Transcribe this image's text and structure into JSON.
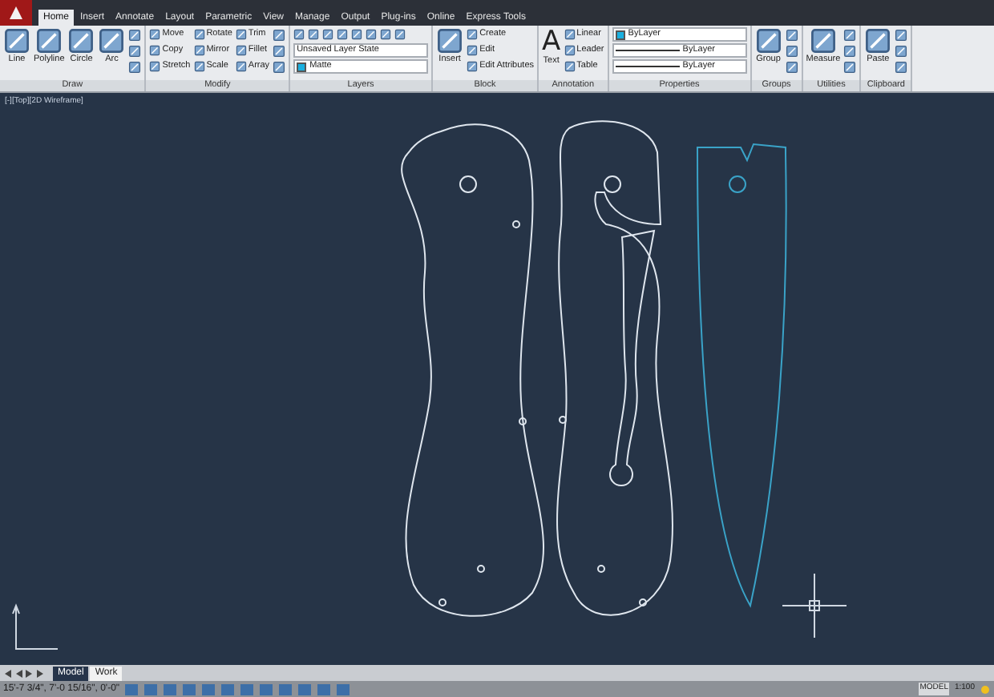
{
  "tabs": [
    {
      "label": "Home",
      "selected": true
    },
    {
      "label": "Insert",
      "selected": false
    },
    {
      "label": "Annotate",
      "selected": false
    },
    {
      "label": "Layout",
      "selected": false
    },
    {
      "label": "Parametric",
      "selected": false
    },
    {
      "label": "View",
      "selected": false
    },
    {
      "label": "Manage",
      "selected": false
    },
    {
      "label": "Output",
      "selected": false
    },
    {
      "label": "Plug-ins",
      "selected": false
    },
    {
      "label": "Online",
      "selected": false
    },
    {
      "label": "Express Tools",
      "selected": false
    }
  ],
  "panels": [
    {
      "title": "Draw",
      "columns": [
        [
          {
            "kind": "large",
            "label": "Line"
          }
        ],
        [
          {
            "kind": "large",
            "label": "Polyline"
          }
        ],
        [
          {
            "kind": "large",
            "label": "Circle"
          }
        ],
        [
          {
            "kind": "large",
            "label": "Arc"
          }
        ],
        [
          {
            "kind": "icon"
          },
          {
            "kind": "icon"
          },
          {
            "kind": "icon"
          }
        ]
      ]
    },
    {
      "title": "Modify",
      "columns": [
        [
          {
            "kind": "small",
            "label": "Move"
          },
          {
            "kind": "small",
            "label": "Copy"
          },
          {
            "kind": "small",
            "label": "Stretch"
          }
        ],
        [
          {
            "kind": "small",
            "label": "Rotate"
          },
          {
            "kind": "small",
            "label": "Mirror"
          },
          {
            "kind": "small",
            "label": "Scale"
          }
        ],
        [
          {
            "kind": "small",
            "label": "Trim"
          },
          {
            "kind": "small",
            "label": "Fillet"
          },
          {
            "kind": "small",
            "label": "Array"
          }
        ],
        [
          {
            "kind": "icon"
          },
          {
            "kind": "icon"
          },
          {
            "kind": "icon"
          }
        ]
      ]
    },
    {
      "title": "Layers",
      "columns": [
        [
          {
            "kind": "iconrow"
          },
          {
            "kind": "dropdown",
            "label": "Unsaved Layer State"
          },
          {
            "kind": "dropdown",
            "label": "Matte",
            "color": "#1ab0e0"
          }
        ]
      ]
    },
    {
      "title": "Block",
      "columns": [
        [
          {
            "kind": "large",
            "label": "Insert"
          }
        ],
        [
          {
            "kind": "small",
            "label": "Create"
          },
          {
            "kind": "small",
            "label": "Edit"
          },
          {
            "kind": "small",
            "label": "Edit Attributes"
          }
        ]
      ]
    },
    {
      "title": "Annotation",
      "columns": [
        [
          {
            "kind": "text",
            "label": "Text",
            "glyph": "A"
          }
        ],
        [
          {
            "kind": "small",
            "label": "Linear"
          },
          {
            "kind": "small",
            "label": "Leader"
          },
          {
            "kind": "small",
            "label": "Table"
          }
        ]
      ]
    },
    {
      "title": "Properties",
      "columns": [
        [
          {
            "kind": "dropdown",
            "label": "ByLayer",
            "color": "#1ab0e0"
          },
          {
            "kind": "linetype",
            "label": "ByLayer"
          },
          {
            "kind": "linetype",
            "label": "ByLayer"
          }
        ]
      ]
    },
    {
      "title": "Groups",
      "columns": [
        [
          {
            "kind": "large",
            "label": "Group"
          }
        ],
        [
          {
            "kind": "icon"
          },
          {
            "kind": "icon"
          },
          {
            "kind": "icon"
          }
        ]
      ]
    },
    {
      "title": "Utilities",
      "columns": [
        [
          {
            "kind": "large",
            "label": "Measure"
          }
        ],
        [
          {
            "kind": "icon"
          },
          {
            "kind": "icon"
          },
          {
            "kind": "icon"
          }
        ]
      ]
    },
    {
      "title": "Clipboard",
      "columns": [
        [
          {
            "kind": "large",
            "label": "Paste"
          }
        ],
        [
          {
            "kind": "icon"
          },
          {
            "kind": "icon"
          },
          {
            "kind": "icon"
          }
        ]
      ]
    }
  ],
  "viewport_label": "[-][Top][2D Wireframe]",
  "layout_tabs": [
    {
      "label": "Model",
      "selected": true
    },
    {
      "label": "Work",
      "selected": false
    }
  ],
  "status_bar": {
    "coordinates": "15'-7 3/4\", 7'-0 15/16\", 0'-0\"",
    "space": "MODEL",
    "scale": "1:100"
  }
}
